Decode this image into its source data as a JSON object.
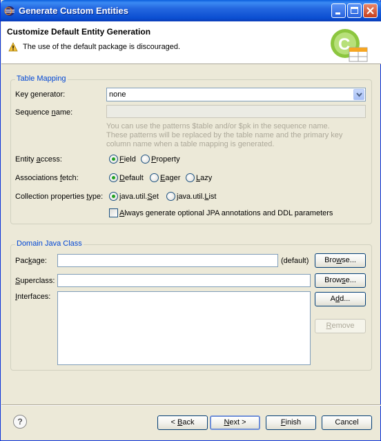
{
  "window": {
    "title": "Generate Custom Entities"
  },
  "header": {
    "title": "Customize Default Entity Generation",
    "message": "The use of the default package is discouraged."
  },
  "table_mapping": {
    "group_label": "Table Mapping",
    "key_generator": {
      "label_pre": "Key ",
      "label_mn": "g",
      "label_post": "enerator:",
      "value": "none"
    },
    "sequence_name": {
      "label_pre": "Sequence ",
      "label_mn": "n",
      "label_post": "ame:",
      "value": ""
    },
    "hint": [
      "You can use the patterns $table and/or $pk in the sequence name.",
      "These patterns will be replaced by the table name and the primary key",
      "column name when a table mapping is generated."
    ],
    "entity_access": {
      "label_pre": "Entity ",
      "label_mn": "a",
      "label_post": "ccess:",
      "options": [
        {
          "pre": "",
          "mn": "F",
          "post": "ield",
          "selected": true
        },
        {
          "pre": "",
          "mn": "P",
          "post": "roperty",
          "selected": false
        }
      ]
    },
    "associations_fetch": {
      "label_pre": "Associations ",
      "label_mn": "f",
      "label_post": "etch:",
      "options": [
        {
          "pre": "",
          "mn": "D",
          "post": "efault",
          "selected": true
        },
        {
          "pre": "",
          "mn": "E",
          "post": "ager",
          "selected": false
        },
        {
          "pre": "",
          "mn": "L",
          "post": "azy",
          "selected": false
        }
      ]
    },
    "collection_type": {
      "label_pre": "Collection properties ",
      "label_mn": "t",
      "label_post": "ype:",
      "options": [
        {
          "pre": "java.util.",
          "mn": "S",
          "post": "et",
          "selected": true
        },
        {
          "pre": "java.util.",
          "mn": "L",
          "post": "ist",
          "selected": false
        }
      ]
    },
    "always_generate": {
      "pre": "",
      "mn": "A",
      "post": "lways generate optional JPA annotations and DDL parameters",
      "checked": false
    }
  },
  "domain_class": {
    "group_label": "Domain Java Class",
    "package": {
      "label_pre": "Pac",
      "label_mn": "k",
      "label_post": "age:",
      "value": "",
      "suffix": "(default)"
    },
    "superclass": {
      "label_pre": "",
      "label_mn": "S",
      "label_post": "uperclass:",
      "value": ""
    },
    "interfaces": {
      "label_pre": "",
      "label_mn": "I",
      "label_post": "nterfaces:"
    },
    "browse1": {
      "pre": "Bro",
      "mn": "w",
      "post": "se..."
    },
    "browse2": {
      "pre": "Brow",
      "mn": "s",
      "post": "e..."
    },
    "add": {
      "pre": "A",
      "mn": "d",
      "post": "d..."
    },
    "remove": {
      "pre": "",
      "mn": "R",
      "post": "emove"
    }
  },
  "footer": {
    "help": "?",
    "back": {
      "pre": "< ",
      "mn": "B",
      "post": "ack"
    },
    "next": {
      "pre": "",
      "mn": "N",
      "post": "ext >"
    },
    "finish": {
      "pre": "",
      "mn": "F",
      "post": "inish"
    },
    "cancel": "Cancel"
  },
  "colors": {
    "titlebar": "#0b4ed1",
    "group_label": "#0046d5",
    "radio_dot": "#21a121",
    "hint": "#aca899"
  }
}
